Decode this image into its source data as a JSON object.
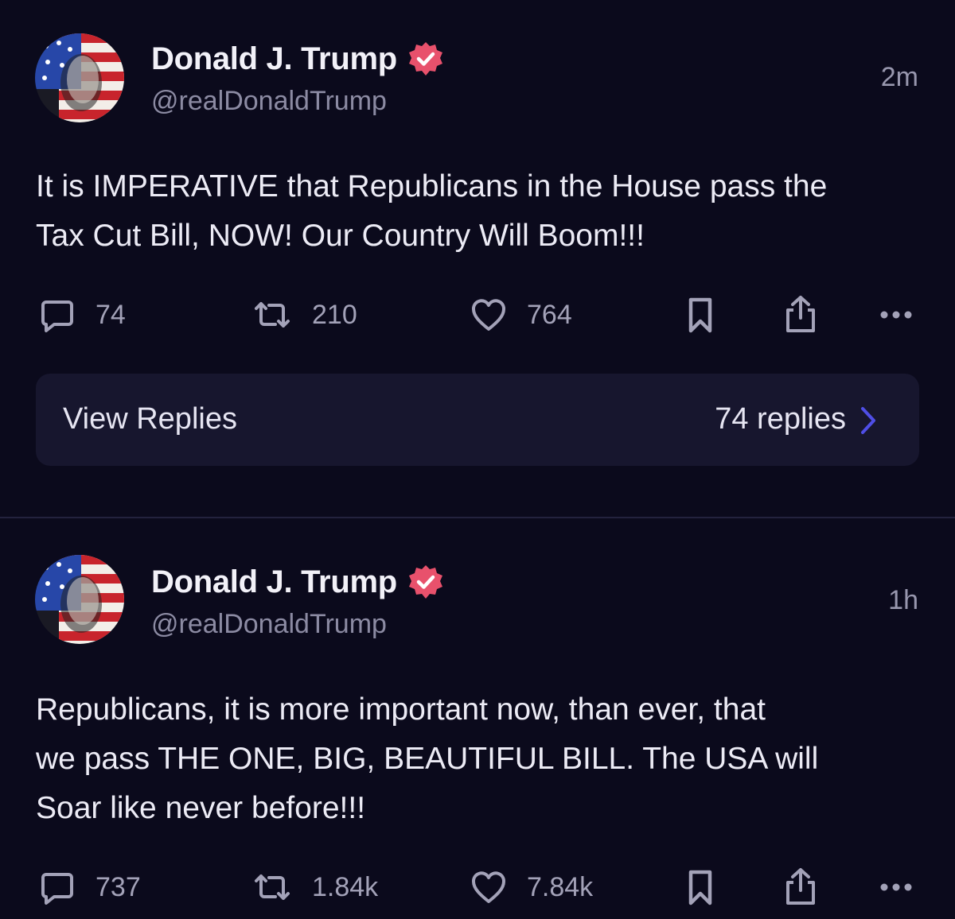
{
  "colors": {
    "background": "#0b0a1c",
    "verified_badge": "#e8516c",
    "replies_chevron": "#4f4ee6"
  },
  "posts": [
    {
      "author": {
        "name": "Donald J. Trump",
        "handle": "@realDonaldTrump",
        "verified": true,
        "avatar_icon": "flag-portrait-avatar"
      },
      "time": "2m",
      "text_lines": [
        "It is IMPERATIVE that Republicans in the House pass the",
        "Tax Cut Bill, NOW! Our Country Will Boom!!!"
      ],
      "stats": {
        "replies": "74",
        "reposts": "210",
        "likes": "764"
      },
      "view_replies": {
        "label": "View Replies",
        "count_label": "74 replies"
      }
    },
    {
      "author": {
        "name": "Donald J. Trump",
        "handle": "@realDonaldTrump",
        "verified": true,
        "avatar_icon": "flag-portrait-avatar"
      },
      "time": "1h",
      "text_lines": [
        "Republicans, it is more important now, than ever, that",
        "we pass THE ONE, BIG, BEAUTIFUL BILL. The USA will",
        "Soar like never before!!!"
      ],
      "stats": {
        "replies": "737",
        "reposts": "1.84k",
        "likes": "7.84k"
      }
    }
  ],
  "icons": [
    "reply-icon",
    "repost-icon",
    "like-icon",
    "bookmark-icon",
    "share-icon",
    "more-icon",
    "verified-badge-icon",
    "chevron-right-icon"
  ]
}
